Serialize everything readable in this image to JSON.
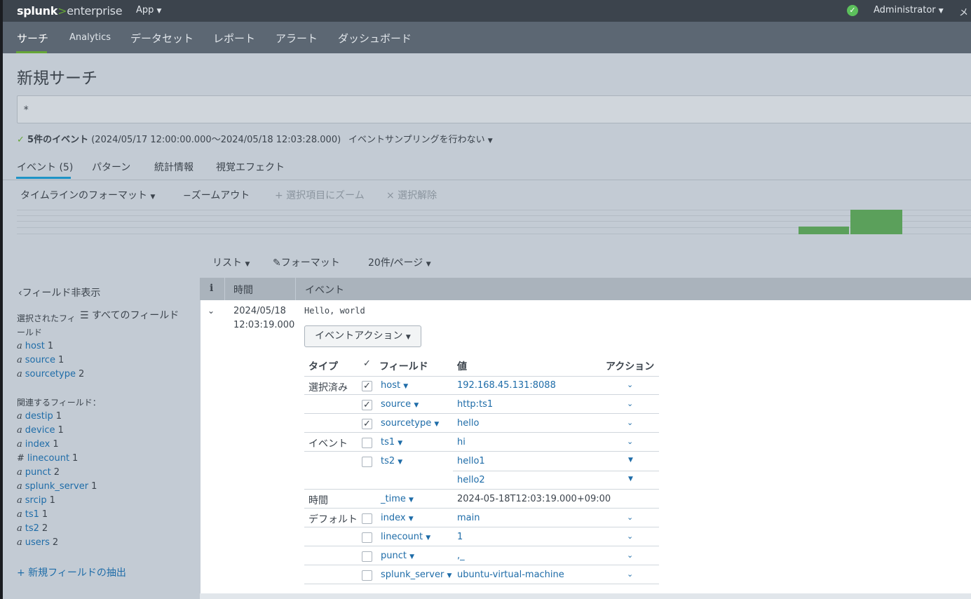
{
  "topbar": {
    "logo_a": "splunk",
    "logo_b": ">",
    "logo_c": "enterprise",
    "app_menu": "App",
    "status_icon": "check-circle-icon",
    "admin_menu": "Administrator",
    "messages_menu": "メ"
  },
  "nav": {
    "items": [
      "サーチ",
      "Analytics",
      "データセット",
      "レポート",
      "アラート",
      "ダッシュボード"
    ],
    "active": "サーチ"
  },
  "page": {
    "title": "新規サーチ",
    "search_query": "*",
    "check": "✓",
    "event_count": "5件のイベント",
    "time_range": "(2024/05/17 12:00:00.000〜2024/05/18 12:03:28.000)",
    "sampling": "イベントサンプリングを行わない"
  },
  "tabs": [
    "イベント (5)",
    "パターン",
    "統計情報",
    "視覚エフェクト"
  ],
  "timeline": {
    "format": "タイムラインのフォーマット",
    "zoom_out": "−ズームアウト",
    "zoom_selection": "+ 選択項目にズーム",
    "deselect": "× 選択解除",
    "bars_relative_height": [
      0.32,
      1.0
    ]
  },
  "results_toolbar": {
    "list": "リスト",
    "format": "フォーマット",
    "per_page": "20件/ページ"
  },
  "left_panel": {
    "hide_fields": "フィールド非表示",
    "selected_label": "選択されたフィールド",
    "all_fields": "すべてのフィールド",
    "selected_fields": [
      {
        "type": "a",
        "name": "host",
        "count": "1"
      },
      {
        "type": "a",
        "name": "source",
        "count": "1"
      },
      {
        "type": "a",
        "name": "sourcetype",
        "count": "2"
      }
    ],
    "related_label": "関連するフィールド：",
    "related_fields": [
      {
        "type": "a",
        "name": "destip",
        "count": "1"
      },
      {
        "type": "a",
        "name": "device",
        "count": "1"
      },
      {
        "type": "a",
        "name": "index",
        "count": "1"
      },
      {
        "type": "#",
        "name": "linecount",
        "count": "1"
      },
      {
        "type": "a",
        "name": "punct",
        "count": "2"
      },
      {
        "type": "a",
        "name": "splunk_server",
        "count": "1"
      },
      {
        "type": "a",
        "name": "srcip",
        "count": "1"
      },
      {
        "type": "a",
        "name": "ts1",
        "count": "1"
      },
      {
        "type": "a",
        "name": "ts2",
        "count": "2"
      },
      {
        "type": "a",
        "name": "users",
        "count": "2"
      }
    ],
    "extract": "+ 新規フィールドの抽出"
  },
  "table": {
    "col_i": "i",
    "col_time": "時間",
    "col_event": "イベント",
    "event": {
      "date": "2024/05/18",
      "time": "12:03:19.000",
      "raw": "Hello, world",
      "action_button": "イベントアクション"
    }
  },
  "field_table": {
    "headers": {
      "type": "タイプ",
      "field": "フィールド",
      "value": "値",
      "action": "アクション"
    },
    "rows": [
      {
        "group": "選択済み",
        "checked": true,
        "name": "host",
        "value": "192.168.45.131:8088"
      },
      {
        "group": "",
        "checked": true,
        "name": "source",
        "value": "http:ts1"
      },
      {
        "group": "",
        "checked": true,
        "name": "sourcetype",
        "value": "hello"
      },
      {
        "group": "イベント",
        "checked": false,
        "name": "ts1",
        "value": "hi"
      },
      {
        "group": "",
        "checked": false,
        "name": "ts2",
        "value": "hello1"
      },
      {
        "group": "",
        "checked": null,
        "name": "",
        "value": "hello2"
      },
      {
        "group": "時間",
        "checked": null,
        "name": "_time",
        "value": "2024-05-18T12:03:19.000+09:00"
      },
      {
        "group": "デフォルト",
        "checked": false,
        "name": "index",
        "value": "main"
      },
      {
        "group": "",
        "checked": false,
        "name": "linecount",
        "value": "1"
      },
      {
        "group": "",
        "checked": false,
        "name": "punct",
        "value": ",_"
      },
      {
        "group": "",
        "checked": false,
        "name": "splunk_server",
        "value": "ubuntu-virtual-machine"
      }
    ]
  }
}
